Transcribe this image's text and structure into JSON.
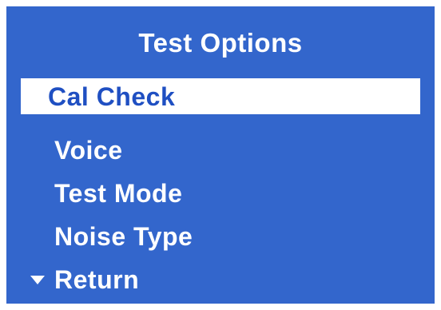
{
  "screen": {
    "title": "Test Options",
    "items": [
      {
        "label": "Cal Check",
        "selected": true
      },
      {
        "label": "Voice"
      },
      {
        "label": "Test Mode"
      },
      {
        "label": "Noise Type"
      },
      {
        "label": "Return",
        "icon": "triangle-down-icon"
      }
    ],
    "colors": {
      "background": "#3366cc",
      "text": "#ffffff",
      "selection_background": "#ffffff",
      "selection_text": "#1f4fc2"
    }
  }
}
